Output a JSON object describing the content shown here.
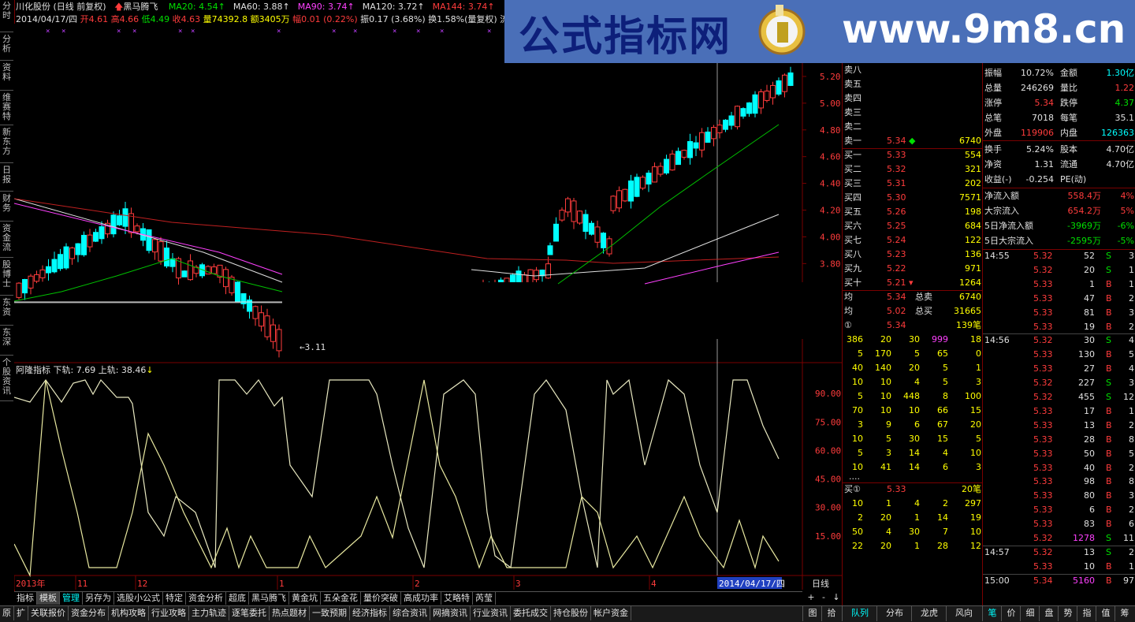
{
  "left_tabs": [
    "分时",
    "分析",
    "资料",
    "维赛特",
    "新东方",
    "日报",
    "财务",
    "资金流",
    "股博士",
    "东资",
    "东深",
    "个股资讯"
  ],
  "header": {
    "title": "川化股份 (日线 前复权)",
    "formula_name": "黑马腾飞",
    "ma_items": [
      {
        "label": "MA20:",
        "value": "4.54↑",
        "color": "#00e000"
      },
      {
        "label": "MA60:",
        "value": "3.88↑",
        "color": "#e0e0e0"
      },
      {
        "label": "MA90:",
        "value": "3.74↑",
        "color": "#ff40ff"
      },
      {
        "label": "MA120:",
        "value": "3.72↑",
        "color": "#e0e0e0"
      },
      {
        "label": "MA144:",
        "value": "3.74↑",
        "color": "#ff3c3c"
      }
    ],
    "info_line": {
      "date": "2014/04/17/四",
      "open": "开4.61",
      "high": "高4.66",
      "low": "低4.49",
      "close": "收4.63",
      "volume": "量74392.8",
      "amount": "额3405万",
      "change": "幅0.01 (0.22%)",
      "amplitude": "振0.17 (3.68%)",
      "turnover": "换1.58%(量复权)",
      "extra": "流通"
    }
  },
  "banner": {
    "cn": "公式指标网",
    "url": "www.9m8.cn"
  },
  "price_axis": [
    "5.20",
    "5.00",
    "4.80",
    "4.60",
    "4.40",
    "4.20",
    "4.00",
    "3.80"
  ],
  "chart_annotations": {
    "low_label": "←3.11"
  },
  "indicator": {
    "name": "阿隆指标",
    "lower_label": "下轨: 7.69",
    "upper_label": "上轨: 38.46",
    "axis": [
      "90.00",
      "75.00",
      "60.00",
      "45.00",
      "30.00",
      "15.00"
    ]
  },
  "date_axis": [
    "2013年",
    "11",
    "12",
    "1",
    "2",
    "3",
    "4"
  ],
  "date_cursor": "2014/04/17/四",
  "period_label": "日线",
  "order_book": {
    "sell": [
      {
        "label": "卖八",
        "price": "",
        "vol": ""
      },
      {
        "label": "卖五",
        "price": "",
        "vol": ""
      },
      {
        "label": "卖四",
        "price": "",
        "vol": ""
      },
      {
        "label": "卖三",
        "price": "",
        "vol": ""
      },
      {
        "label": "卖二",
        "price": "",
        "vol": ""
      },
      {
        "label": "卖一",
        "price": "5.34",
        "vol": "6740"
      }
    ],
    "buy": [
      {
        "label": "买一",
        "price": "5.33",
        "vol": "554"
      },
      {
        "label": "买二",
        "price": "5.32",
        "vol": "321"
      },
      {
        "label": "买三",
        "price": "5.31",
        "vol": "202"
      },
      {
        "label": "买四",
        "price": "5.30",
        "vol": "7571"
      },
      {
        "label": "买五",
        "price": "5.26",
        "vol": "198"
      },
      {
        "label": "买六",
        "price": "5.25",
        "vol": "684"
      },
      {
        "label": "买七",
        "price": "5.24",
        "vol": "122"
      },
      {
        "label": "买八",
        "price": "5.23",
        "vol": "136"
      },
      {
        "label": "买九",
        "price": "5.22",
        "vol": "971"
      },
      {
        "label": "买十",
        "price": "5.21",
        "vol": "1264"
      }
    ],
    "avg": [
      {
        "label": "均",
        "price": "5.34",
        "tlabel": "总卖",
        "tval": "6740"
      },
      {
        "label": "均",
        "price": "5.02",
        "tlabel": "总买",
        "tval": "31665"
      }
    ],
    "queue1": {
      "label": "①",
      "price": "5.34",
      "count": "139笔"
    },
    "queue1_rows": [
      [
        "386",
        "20",
        "30",
        "999",
        "18"
      ],
      [
        "5",
        "170",
        "5",
        "65",
        "0"
      ],
      [
        "40",
        "140",
        "20",
        "5",
        "1"
      ],
      [
        "10",
        "10",
        "4",
        "5",
        "3"
      ],
      [
        "5",
        "10",
        "448",
        "8",
        "100"
      ],
      [
        "70",
        "10",
        "10",
        "66",
        "15"
      ],
      [
        "3",
        "9",
        "6",
        "67",
        "20"
      ],
      [
        "10",
        "5",
        "30",
        "15",
        "5"
      ],
      [
        "5",
        "3",
        "14",
        "4",
        "10"
      ],
      [
        "10",
        "41",
        "14",
        "6",
        "3"
      ]
    ],
    "queue2": {
      "label": "买①",
      "price": "5.33",
      "count": "20笔"
    },
    "queue2_rows": [
      [
        "10",
        "1",
        "4",
        "2",
        "297"
      ],
      [
        "2",
        "20",
        "1",
        "14",
        "19"
      ],
      [
        "50",
        "4",
        "30",
        "7",
        "10"
      ],
      [
        "22",
        "20",
        "1",
        "28",
        "12"
      ]
    ]
  },
  "stats": [
    {
      "l1": "振幅",
      "v1": "10.72%",
      "l2": "金额",
      "v2": "1.30亿",
      "c1": "#e0e0e0",
      "c2": "#00ffff"
    },
    {
      "l1": "总量",
      "v1": "246269",
      "l2": "量比",
      "v2": "1.22",
      "c1": "#e0e0e0",
      "c2": "#ff3c3c"
    },
    {
      "l1": "涨停",
      "v1": "5.34",
      "l2": "跌停",
      "v2": "4.37",
      "c1": "#ff3c3c",
      "c2": "#00e000"
    },
    {
      "l1": "总笔",
      "v1": "7018",
      "l2": "每笔",
      "v2": "35.1",
      "c1": "#e0e0e0",
      "c2": "#e0e0e0"
    },
    {
      "l1": "外盘",
      "v1": "119906",
      "l2": "内盘",
      "v2": "126363",
      "c1": "#ff3c3c",
      "c2": "#00ffff"
    },
    {
      "l1": "换手",
      "v1": "5.24%",
      "l2": "股本",
      "v2": "4.70亿",
      "c1": "#e0e0e0",
      "c2": "#e0e0e0"
    },
    {
      "l1": "净资",
      "v1": "1.31",
      "l2": "流通",
      "v2": "4.70亿",
      "c1": "#e0e0e0",
      "c2": "#e0e0e0"
    },
    {
      "l1": "收益(-)",
      "v1": "-0.254",
      "l2": "PE(动)",
      "v2": "",
      "c1": "#e0e0e0",
      "c2": "#e0e0e0"
    }
  ],
  "flows": [
    {
      "label": "净流入额",
      "value": "558.4万",
      "pct": "4%",
      "color": "#ff3c3c"
    },
    {
      "label": "大宗流入",
      "value": "654.2万",
      "pct": "5%",
      "color": "#ff3c3c"
    },
    {
      "label": "5日净流入额",
      "value": "-3969万",
      "pct": "-6%",
      "color": "#00e000"
    },
    {
      "label": "5日大宗流入",
      "value": "-2595万",
      "pct": "-5%",
      "color": "#00e000"
    }
  ],
  "ticks": [
    {
      "time": "14:55",
      "price": "5.32",
      "vol": "52",
      "bs": "S",
      "n": "3"
    },
    {
      "time": "",
      "price": "5.32",
      "vol": "20",
      "bs": "S",
      "n": "1"
    },
    {
      "time": "",
      "price": "5.33",
      "vol": "1",
      "bs": "B",
      "n": "1"
    },
    {
      "time": "",
      "price": "5.33",
      "vol": "47",
      "bs": "B",
      "n": "2"
    },
    {
      "time": "",
      "price": "5.33",
      "vol": "81",
      "bs": "B",
      "n": "3"
    },
    {
      "time": "",
      "price": "5.33",
      "vol": "19",
      "bs": "B",
      "n": "2"
    },
    {
      "time": "14:56",
      "price": "5.32",
      "vol": "30",
      "bs": "S",
      "n": "4"
    },
    {
      "time": "",
      "price": "5.33",
      "vol": "130",
      "bs": "B",
      "n": "5"
    },
    {
      "time": "",
      "price": "5.33",
      "vol": "27",
      "bs": "B",
      "n": "4"
    },
    {
      "time": "",
      "price": "5.32",
      "vol": "227",
      "bs": "S",
      "n": "3"
    },
    {
      "time": "",
      "price": "5.32",
      "vol": "455",
      "bs": "S",
      "n": "12"
    },
    {
      "time": "",
      "price": "5.33",
      "vol": "17",
      "bs": "B",
      "n": "1"
    },
    {
      "time": "",
      "price": "5.33",
      "vol": "13",
      "bs": "B",
      "n": "2"
    },
    {
      "time": "",
      "price": "5.33",
      "vol": "28",
      "bs": "B",
      "n": "8"
    },
    {
      "time": "",
      "price": "5.33",
      "vol": "50",
      "bs": "B",
      "n": "5"
    },
    {
      "time": "",
      "price": "5.33",
      "vol": "40",
      "bs": "B",
      "n": "2"
    },
    {
      "time": "",
      "price": "5.33",
      "vol": "98",
      "bs": "B",
      "n": "8"
    },
    {
      "time": "",
      "price": "5.33",
      "vol": "80",
      "bs": "B",
      "n": "3"
    },
    {
      "time": "",
      "price": "5.33",
      "vol": "6",
      "bs": "B",
      "n": "2"
    },
    {
      "time": "",
      "price": "5.33",
      "vol": "83",
      "bs": "B",
      "n": "6"
    },
    {
      "time": "",
      "price": "5.32",
      "vol": "1278",
      "bs": "S",
      "n": "11"
    },
    {
      "time": "14:57",
      "price": "5.32",
      "vol": "13",
      "bs": "S",
      "n": "2"
    },
    {
      "time": "",
      "price": "5.33",
      "vol": "10",
      "bs": "B",
      "n": "1"
    },
    {
      "time": "15:00",
      "price": "5.34",
      "vol": "5160",
      "bs": "B",
      "n": "97"
    }
  ],
  "bottom_tabs": [
    "指标",
    "模板",
    "管理",
    "另存为",
    "选股小公式",
    "特定",
    "资金分析",
    "超底",
    "黑马腾飞",
    "黄金坑",
    "五朵金花",
    "量价突破",
    "高成功率",
    "艾略特",
    "芮莹"
  ],
  "scroll_buttons": [
    "+",
    "-",
    "↓"
  ],
  "menu": [
    "原",
    "扩",
    "关联报价",
    "资金分布",
    "机构攻略",
    "行业攻略",
    "主力轨迹",
    "逐笔委托",
    "热点题材",
    "一致预期",
    "经济指标",
    "综合资讯",
    "网摘资讯",
    "行业资讯",
    "委托成交",
    "持仓股份",
    "帐户资金"
  ],
  "menu_right": [
    "图",
    "拾"
  ],
  "right_tabs_a": [
    "队列",
    "分布",
    "龙虎",
    "风向"
  ],
  "right_tabs_b": [
    "笔",
    "价",
    "细",
    "盘",
    "势",
    "指",
    "值",
    "筹"
  ],
  "colors": {
    "up": "#ff3c3c",
    "down": "#00ffff",
    "grid": "#7a0000"
  }
}
